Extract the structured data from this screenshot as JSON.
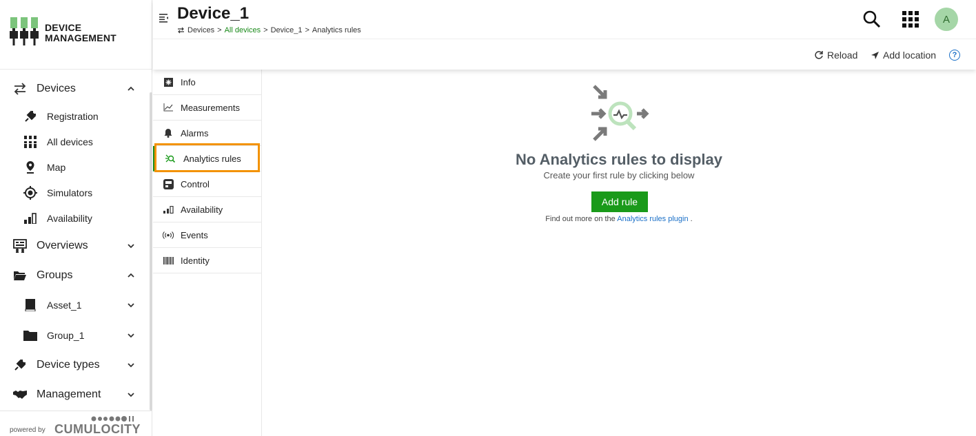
{
  "brand": {
    "line1": "DEVICE",
    "line2": "MANAGEMENT",
    "color": "#7cc47c"
  },
  "nav": {
    "devices": {
      "label": "Devices",
      "icon": "exchange-icon"
    },
    "devices_items": [
      {
        "label": "Registration",
        "icon": "plug-icon"
      },
      {
        "label": "All devices",
        "icon": "devices-icon"
      },
      {
        "label": "Map",
        "icon": "map-pin-icon"
      },
      {
        "label": "Simulators",
        "icon": "simulator-icon"
      },
      {
        "label": "Availability",
        "icon": "bar-chart-icon"
      }
    ],
    "overviews": {
      "label": "Overviews"
    },
    "groups": {
      "label": "Groups"
    },
    "groups_items": [
      {
        "label": "Asset_1",
        "icon": "book-icon"
      },
      {
        "label": "Group_1",
        "icon": "folder-icon"
      }
    ],
    "device_types": {
      "label": "Device types"
    },
    "management": {
      "label": "Management"
    }
  },
  "powered": {
    "by": "powered by",
    "name": "CUMULOCITY"
  },
  "header": {
    "title": "Device_1",
    "breadcrumb": [
      "Devices",
      "All devices",
      "Device_1",
      "Analytics rules"
    ],
    "breadcrumb_sep": ">",
    "avatar": "A",
    "reload": "Reload",
    "add_location": "Add location",
    "help": "?"
  },
  "tabs": [
    {
      "label": "Info",
      "icon": "info-icon"
    },
    {
      "label": "Measurements",
      "icon": "line-chart-icon"
    },
    {
      "label": "Alarms",
      "icon": "bell-icon"
    },
    {
      "label": "Analytics rules",
      "icon": "analytics-icon",
      "active": true
    },
    {
      "label": "Control",
      "icon": "control-icon"
    },
    {
      "label": "Availability",
      "icon": "bar-chart-icon"
    },
    {
      "label": "Events",
      "icon": "broadcast-icon"
    },
    {
      "label": "Identity",
      "icon": "barcode-icon"
    }
  ],
  "empty": {
    "title": "No Analytics rules to display",
    "subtitle": "Create your first rule by clicking below",
    "button": "Add rule",
    "find_prefix": "Find out more on the",
    "find_link": "Analytics rules plugin",
    "find_suffix": "."
  },
  "colors": {
    "accent": "#1a9a1a",
    "highlight": "#f39200",
    "link": "#1a6fc7"
  }
}
